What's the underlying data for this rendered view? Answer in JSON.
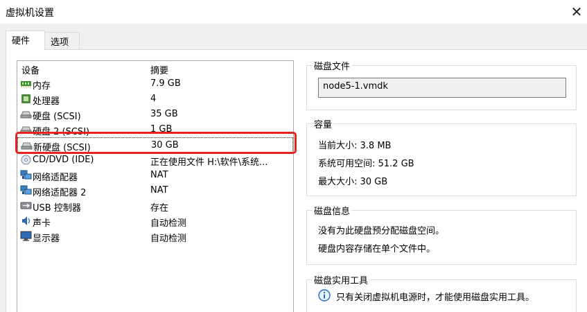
{
  "window": {
    "title": "虚拟机设置",
    "close_glyph": "✕"
  },
  "tabs": [
    {
      "label": "硬件",
      "active": true
    },
    {
      "label": "选项",
      "active": false
    }
  ],
  "device_list": {
    "headers": {
      "device": "设备",
      "summary": "摘要"
    },
    "rows": [
      {
        "icon": "memory-icon",
        "device": "内存",
        "summary": "7.9 GB"
      },
      {
        "icon": "processor-icon",
        "device": "处理器",
        "summary": "4"
      },
      {
        "icon": "disk-icon",
        "device": "硬盘 (SCSI)",
        "summary": "35 GB"
      },
      {
        "icon": "disk-icon",
        "device": "硬盘 2 (SCSI)",
        "summary": "1 GB"
      },
      {
        "icon": "disk-icon",
        "device": "新硬盘 (SCSI)",
        "summary": "30 GB",
        "selected": true
      },
      {
        "icon": "cd-icon",
        "device": "CD/DVD (IDE)",
        "summary": "正在使用文件 H:\\软件\\系统..."
      },
      {
        "icon": "network-icon",
        "device": "网络适配器",
        "summary": "NAT"
      },
      {
        "icon": "network-icon",
        "device": "网络适配器 2",
        "summary": "NAT"
      },
      {
        "icon": "usb-icon",
        "device": "USB 控制器",
        "summary": "存在"
      },
      {
        "icon": "sound-icon",
        "device": "声卡",
        "summary": "自动检测"
      },
      {
        "icon": "display-icon",
        "device": "显示器",
        "summary": "自动检测"
      }
    ]
  },
  "disk_file": {
    "legend": "磁盘文件",
    "value": "node5-1.vmdk"
  },
  "capacity": {
    "legend": "容量",
    "current_size": "当前大小: 3.8 MB",
    "system_free": "系统可用空间: 51.2 GB",
    "max_size": "最大大小: 30 GB"
  },
  "disk_info": {
    "legend": "磁盘信息",
    "line1": "没有为此硬盘预分配磁盘空间。",
    "line2": "硬盘内容存储在单个文件中。"
  },
  "disk_utilities": {
    "legend": "磁盘实用工具",
    "note": "只有关闭虚拟机电源时，才能使用磁盘实用工具。"
  },
  "colors": {
    "highlight": "#e8231f",
    "accent": "#1e6fc4"
  }
}
